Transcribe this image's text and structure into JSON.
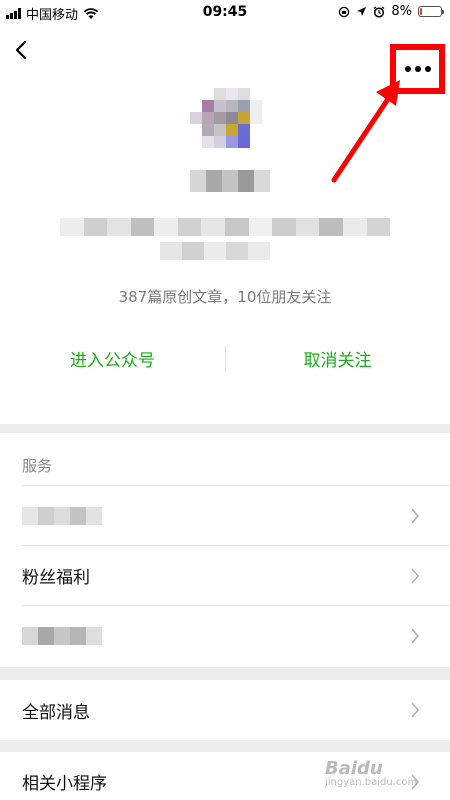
{
  "status_bar": {
    "carrier": "中国移动",
    "time": "09:45",
    "battery_text": "8%",
    "battery_level": 0.08
  },
  "profile": {
    "stats": "387篇原创文章，10位朋友关注",
    "actions": {
      "enter": "进入公众号",
      "unfollow": "取消关注"
    }
  },
  "services": {
    "header": "服务",
    "items": [
      {
        "label": ""
      },
      {
        "label": "粉丝福利"
      },
      {
        "label": ""
      }
    ]
  },
  "all_messages": {
    "label": "全部消息"
  },
  "mini_programs": {
    "label": "相关小程序"
  },
  "watermark": {
    "brand": "Baidu",
    "sub": "jingyan.baidu.com"
  },
  "colors": {
    "accent_green": "#1aad19",
    "highlight_red": "#ff0000",
    "battery_low": "#e53935"
  }
}
